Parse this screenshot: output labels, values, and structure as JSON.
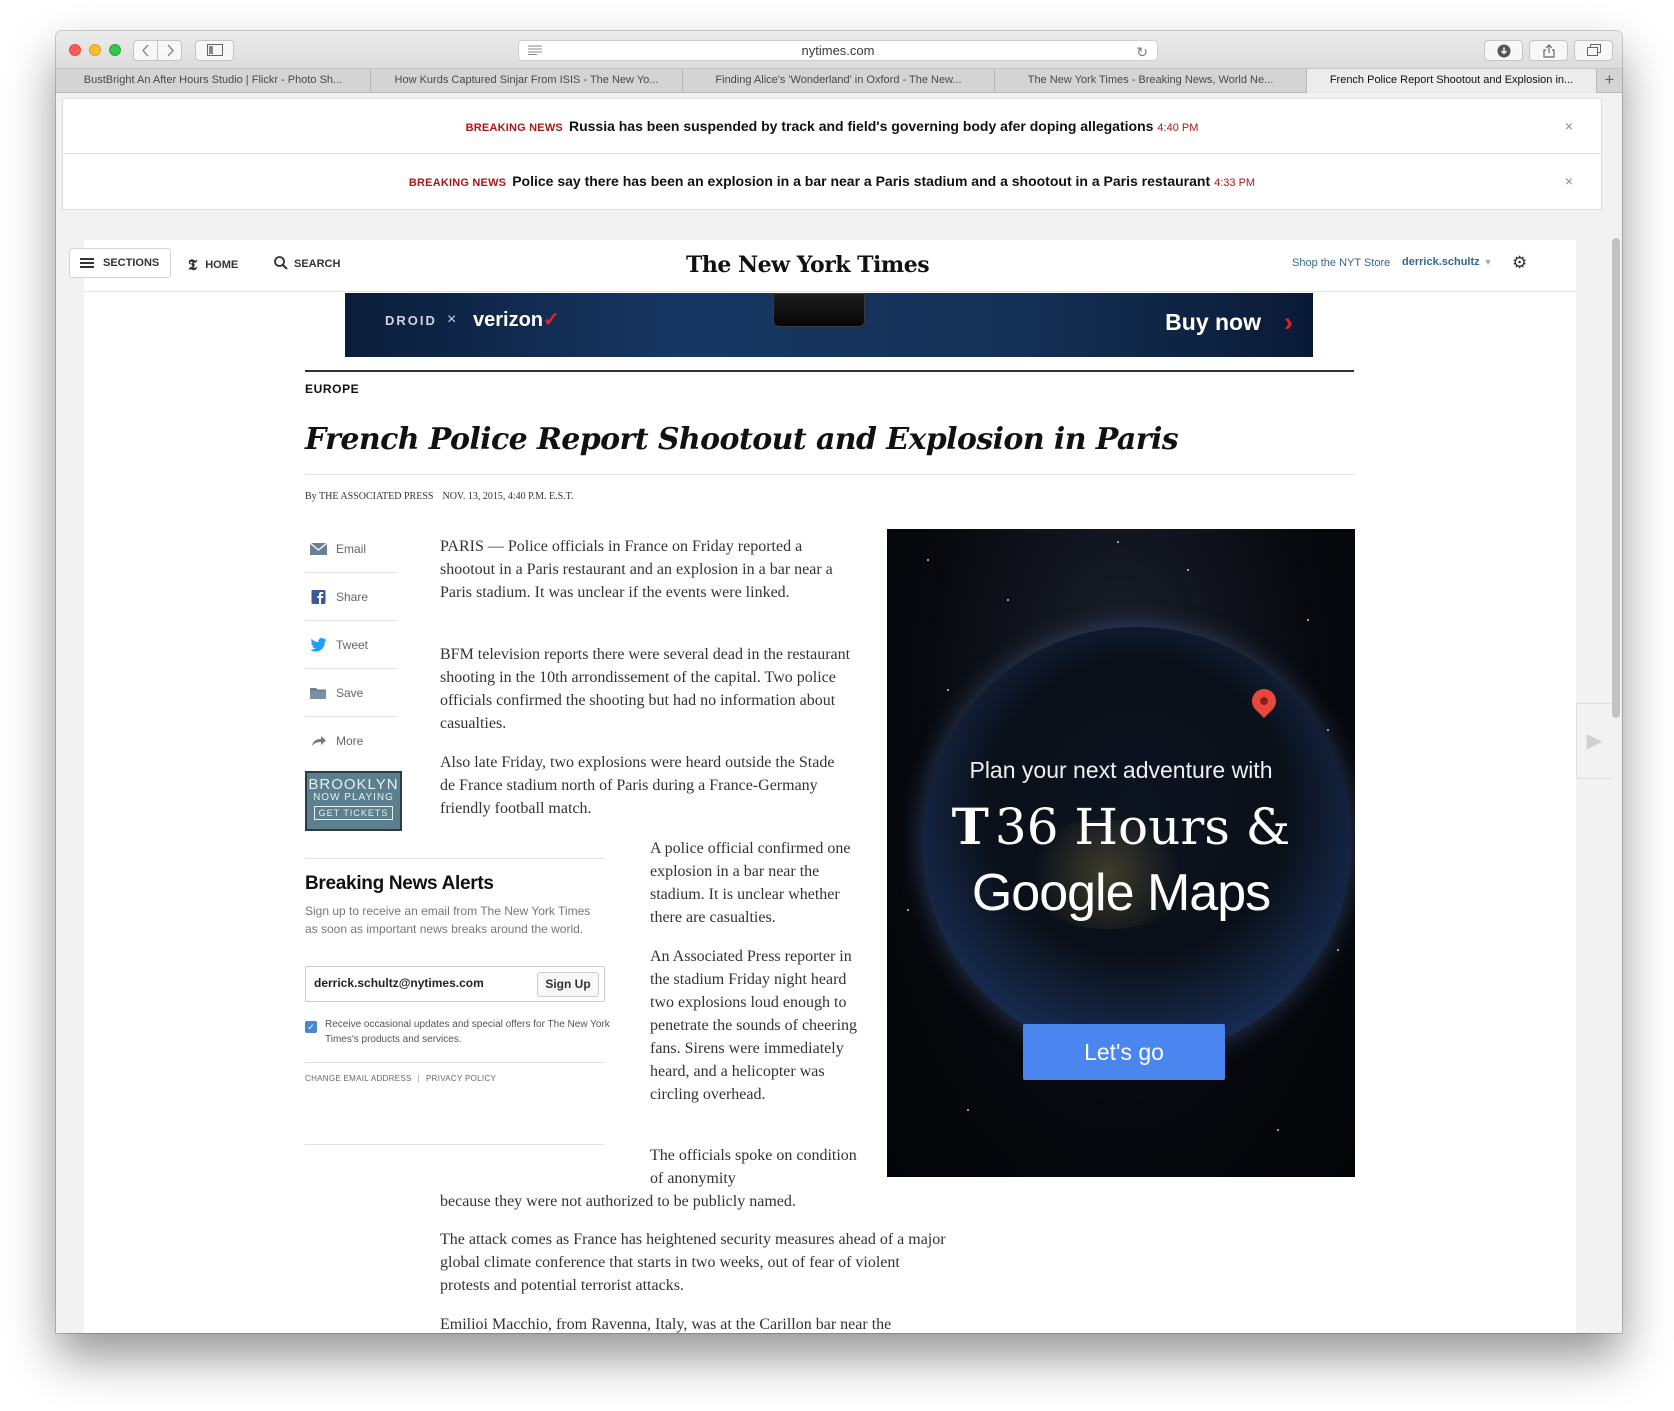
{
  "browser": {
    "url": "nytimes.com",
    "tabs": [
      {
        "label": "BustBright An After Hours Studio | Flickr - Photo Sh...",
        "active": false
      },
      {
        "label": "How Kurds Captured Sinjar From ISIS - The New Yo...",
        "active": false
      },
      {
        "label": "Finding Alice's 'Wonderland' in Oxford - The New...",
        "active": false
      },
      {
        "label": "The New York Times - Breaking News, World Ne...",
        "active": false
      },
      {
        "label": "French Police Report Shootout and Explosion in...",
        "active": true
      }
    ],
    "new_tab": "+"
  },
  "alerts": [
    {
      "tag": "BREAKING NEWS",
      "text": "Russia has been suspended by track and field's governing body afer doping allegations",
      "time": "4:40 PM",
      "close": "×"
    },
    {
      "tag": "BREAKING NEWS",
      "text": "Police say there has been an explosion in a bar near a Paris stadium and a shootout in a Paris restaurant",
      "time": "4:33 PM",
      "close": "×"
    }
  ],
  "masthead": {
    "sections": "SECTIONS",
    "home": "HOME",
    "search": "SEARCH",
    "logo": "The New York Times",
    "store": "Shop the NYT Store",
    "user": "derrick.schultz",
    "caret": "▼",
    "gear": "⚙"
  },
  "top_ad": {
    "droid": "DROID",
    "x": "×",
    "verizon": "verizon",
    "check": "✓",
    "cta": "Buy now",
    "chevron": "›"
  },
  "article": {
    "kicker": "EUROPE",
    "headline": "French Police Report Shootout and Explosion in Paris",
    "byline": "By THE ASSOCIATED PRESS",
    "dateline": "NOV. 13, 2015, 4:40 P.M. E.S.T.",
    "paragraphs": [
      "PARIS — Police officials in France on Friday reported a shootout in a Paris restaurant and an explosion in a bar near a Paris stadium. It was unclear if the events were linked.",
      "BFM television reports there were several dead in the restaurant shooting in the 10th arrondissement of the capital. Two police officials confirmed the shooting but had no information about casualties.",
      "Also late Friday, two explosions were heard outside the Stade de France stadium north of Paris during a France-Germany friendly football match.",
      "A police official confirmed one explosion in a bar near the stadium. It is unclear whether there are casualties.",
      "An Associated Press reporter in the stadium Friday night heard two explosions loud enough to penetrate the sounds of cheering fans. Sirens were immediately heard, and a helicopter was circling overhead.",
      "The officials spoke on condition of anonymity",
      "because they were not authorized to be publicly named.",
      "The attack comes as France has heightened security measures ahead of a major global climate conference that starts in two weeks, out of fear of violent protests and potential terrorist attacks.",
      "Emilioi Macchio, from Ravenna, Italy, was at the Carillon bar near the restaurant that was targeted, having a beer on the sidewalk when the shooting started. He said he didn't see any gunmen or victims, but hid"
    ]
  },
  "share": [
    {
      "label": "Email",
      "icon": "email-icon"
    },
    {
      "label": "Share",
      "icon": "facebook-icon"
    },
    {
      "label": "Tweet",
      "icon": "twitter-icon"
    },
    {
      "label": "Save",
      "icon": "save-icon"
    },
    {
      "label": "More",
      "icon": "share-arrow-icon"
    }
  ],
  "brooklyn_ad": {
    "title": "BROOKLYN",
    "subtitle": "NOW PLAYING",
    "cta": "GET TICKETS"
  },
  "newsletter": {
    "title": "Breaking News Alerts",
    "description": "Sign up to receive an email from The New York Times as soon as important news breaks around the world.",
    "email": "derrick.schultz@nytimes.com",
    "button": "Sign Up",
    "checkbox_label": "Receive occasional updates and special offers for The New York Times's products and services.",
    "link1": "CHANGE EMAIL ADDRESS",
    "separator": "|",
    "link2": "PRIVACY POLICY"
  },
  "google_ad": {
    "line1": "Plan your next adventure with",
    "t_logo": "T",
    "line2": "36 Hours",
    "amp": "&",
    "line3": "Google Maps",
    "cta": "Let's go"
  },
  "colors": {
    "accent_red": "#a81817",
    "link_blue": "#326891",
    "ad_blue": "#4a85f0"
  }
}
